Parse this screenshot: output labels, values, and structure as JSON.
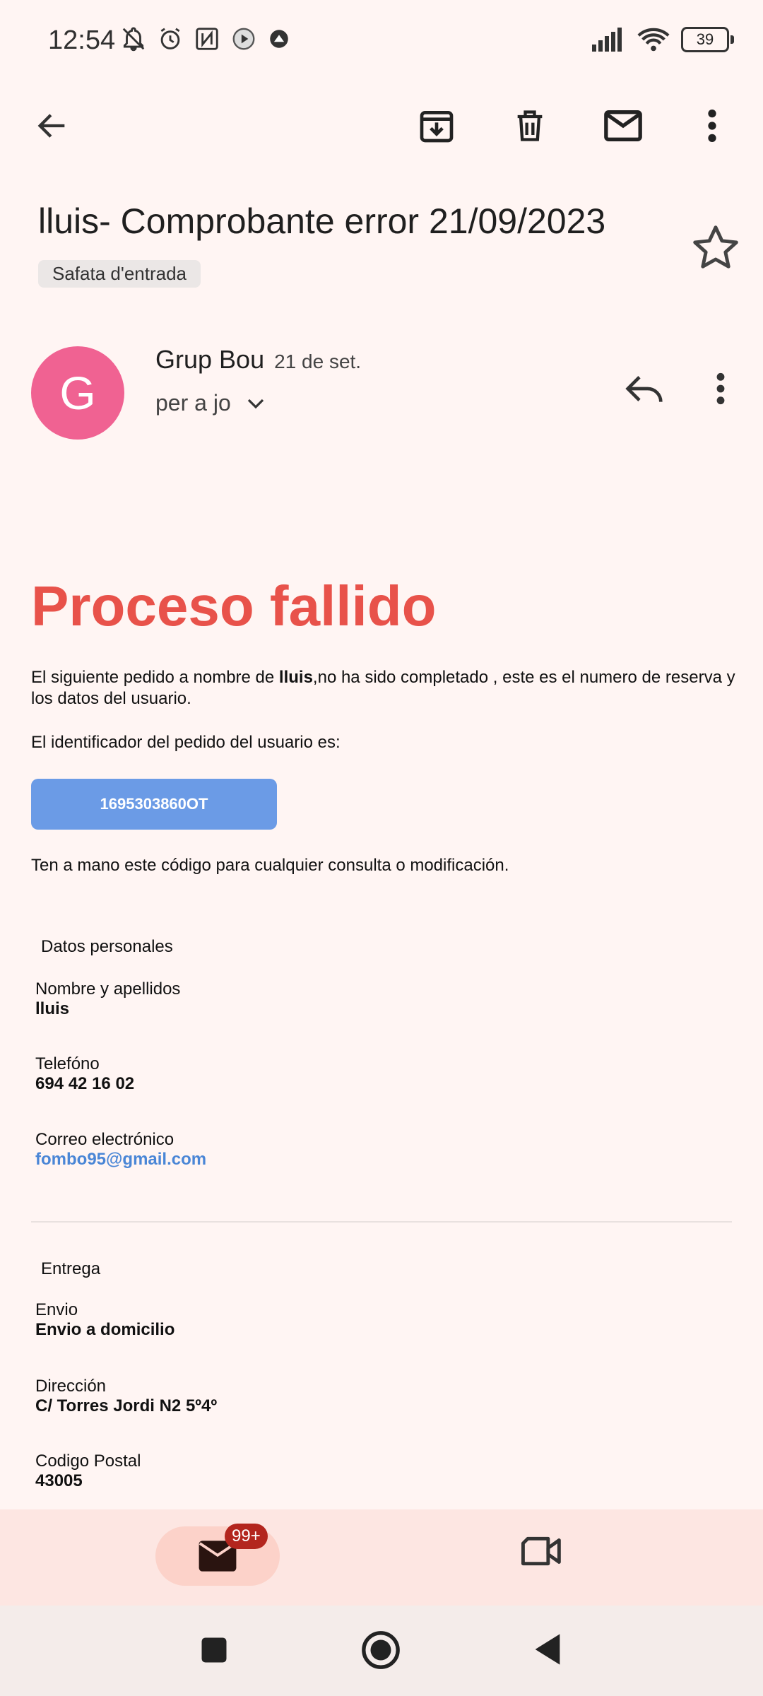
{
  "status_bar": {
    "time": "12:54",
    "battery": "39"
  },
  "toolbar": {
    "back": "back-arrow-icon",
    "archive": "archive-icon",
    "delete": "trash-icon",
    "unread": "mail-icon",
    "more": "more-vert-icon"
  },
  "email": {
    "subject": "lluis- Comprobante error 21/09/2023",
    "label": "Safata d'entrada",
    "avatar_letter": "G",
    "sender": "Grup Bou",
    "date": "21 de set.",
    "recipient": "per a jo"
  },
  "body": {
    "headline": "Proceso fallido",
    "intro_prefix": "El siguiente pedido a nombre de ",
    "intro_name": "lluis",
    "intro_suffix": ",no ha sido completado , este es el numero de reserva y los datos del usuario.",
    "id_label": "El identificador del pedido del usuario es:",
    "order_id": "1695303860OT",
    "keep_note": "Ten a mano este código para cualquier consulta o modificación.",
    "personal": {
      "title": "Datos personales",
      "name_label": "Nombre y apellidos",
      "name_value": "lluis",
      "phone_label": "Telefóno",
      "phone_value": "694 42 16 02",
      "email_label": "Correo electrónico",
      "email_value": "fombo95@gmail.com"
    },
    "delivery": {
      "title": "Entrega",
      "ship_label": "Envio",
      "ship_value": "Envio a domicilio",
      "address_label": "Dirección",
      "address_value": "C/ Torres Jordi N2 5º4º",
      "zip_label": "Codigo Postal",
      "zip_value": "43005"
    }
  },
  "bottom_nav": {
    "mail_badge": "99+"
  },
  "colors": {
    "accent_red": "#e8524a",
    "avatar": "#f06292",
    "button_blue": "#6b9be6",
    "link": "#4a86d6"
  }
}
